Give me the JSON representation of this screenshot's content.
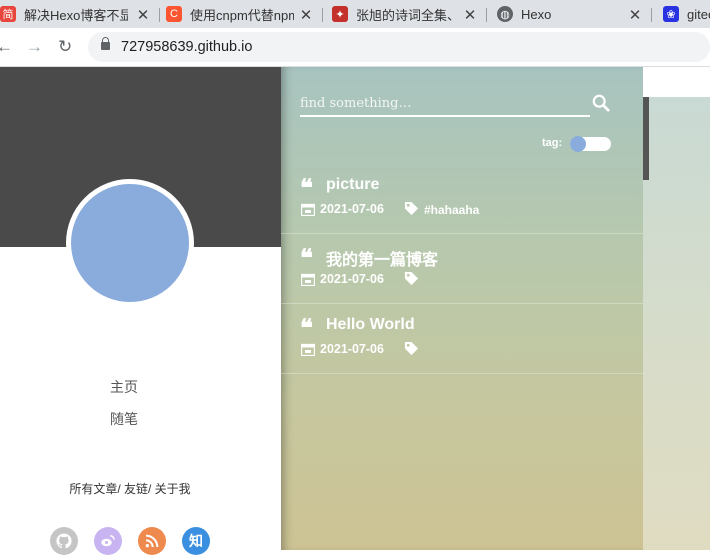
{
  "browser": {
    "tabs": [
      {
        "title": "解决Hexo博客不显",
        "fav": "简",
        "fav_color": "#e8453c"
      },
      {
        "title": "使用cnpm代替npm",
        "fav": "C",
        "fav_color": "#fc5531"
      },
      {
        "title": "张旭的诗词全集、",
        "fav": "✦",
        "fav_color": "#c4302b"
      },
      {
        "title": "Hexo",
        "fav": "◍",
        "fav_color": "#5f6368"
      },
      {
        "title": "gitee",
        "fav": "❀",
        "fav_color": "#2932e1"
      }
    ],
    "url": "727958639.github.io"
  },
  "sidebar": {
    "menu": [
      "主页",
      "随笔"
    ],
    "links": "所有文章/ 友链/ 关于我",
    "social": [
      {
        "icon": "github-icon",
        "glyph": "◕",
        "color": "#c5c5c5"
      },
      {
        "icon": "weibo-icon",
        "glyph": "◉",
        "color": "#c8b4f0"
      },
      {
        "icon": "rss-icon",
        "glyph": "◠",
        "color": "#ef8a4e"
      },
      {
        "icon": "zhihu-icon",
        "glyph": "知",
        "color": "#3b8fe0"
      }
    ]
  },
  "search": {
    "placeholder": "find something…",
    "tag_label": "tag:"
  },
  "posts": [
    {
      "title": "picture",
      "date": "2021-07-06",
      "tag": "#hahaaha"
    },
    {
      "title": "我的第一篇博客",
      "date": "2021-07-06",
      "tag": ""
    },
    {
      "title": "Hello World",
      "date": "2021-07-06",
      "tag": ""
    }
  ]
}
